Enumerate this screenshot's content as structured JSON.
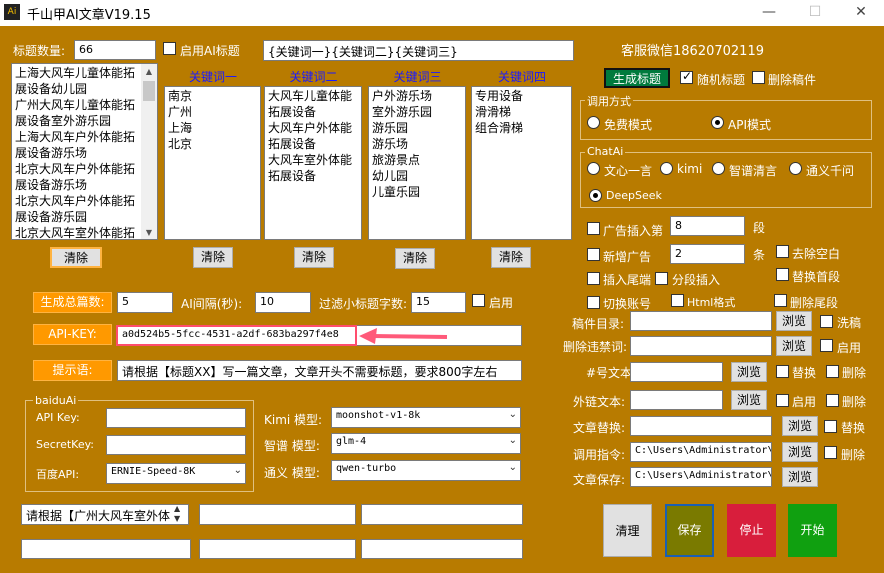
{
  "window": {
    "title": "千山甲AI文章V19.15",
    "icon": "Ai"
  },
  "labels": {
    "title_count": "标题数量:",
    "enable_ai_title": "启用AI标题",
    "wechat": "客服微信18620702119",
    "gen_count": "生成总篇数:",
    "ai_interval": "AI间隔(秒):",
    "filter_subtitle": "过滤小标题字数:",
    "enable": "启用",
    "api_key": "API-KEY:",
    "prompt": "提示语:",
    "random_title": "随机标题",
    "delete_drafts": "删除稿件",
    "call_mode": "调用方式",
    "free_mode": "免费模式",
    "api_mode": "API模式",
    "chatai": "ChatAi",
    "wenxin": "文心一言",
    "kimi": "kimi",
    "zhipu": "智谱清言",
    "tongyi": "通义千问",
    "deepseek": "DeepSeek",
    "ad_insert": "广告插入第",
    "ad_unit": "段",
    "new_ad": "新增广告",
    "new_ad_unit": "条",
    "remove_blank": "去除空白",
    "insert_tail": "插入尾端",
    "para_insert": "分段插入",
    "replace_first": "替换首段",
    "switch_account": "切换账号",
    "html_format": "Html格式",
    "delete_tail": "删除尾段",
    "draft_dir": "稿件目录:",
    "banned_words": "删除违禁词:",
    "hash_text": "#号文本:",
    "link_text": "外链文本:",
    "article_replace": "文章替换:",
    "call_cmd": "调用指令:",
    "article_save": "文章保存:",
    "wash": "洗稿",
    "replace": "替换",
    "delete": "删除",
    "baiduai": "baiduAi",
    "baidu_api_key": "API Key:",
    "baidu_secret": "SecretKey:",
    "baidu_api": "百度API:",
    "kimi_model": "Kimi 模型:",
    "zhipu_model": "智谱 模型:",
    "tongyi_model": "通义 模型:"
  },
  "buttons": {
    "generate_title": "生成标题",
    "clear": "清除",
    "browse": "浏览",
    "clean": "清理",
    "save": "保存",
    "stop": "停止",
    "start": "开始"
  },
  "inputs": {
    "title_count": "66",
    "keyword_template": "{关键词一}{关键词二}{关键词三}",
    "gen_count": "5",
    "ai_interval": "10",
    "filter_subtitle": "15",
    "api_key": "a0d524b5-5fcc-4531-a2df-683ba297f4e8",
    "prompt": "请根据【标题XX】写一篇文章，文章开头不需要标题，要求800字左右",
    "ad_insert_para": "8",
    "new_ad_count": "2",
    "call_cmd": "C:\\Users\\Administrator\\",
    "article_save": "C:\\Users\\Administrator\\",
    "baidu_api": "ERNIE-Speed-8K",
    "kimi_model": "moonshot-v1-8k",
    "zhipu_model": "glm-4",
    "tongyi_model": "qwen-turbo",
    "bottom_prompt": "请根据【广州大风车室外体"
  },
  "columns": [
    {
      "header": "",
      "items": [
        "上海大风车儿童体能拓展设备幼儿园",
        "广州大风车儿童体能拓展设备室外游乐园",
        "上海大风车户外体能拓展设备游乐场",
        "北京大风车户外体能拓展设备游乐场",
        "北京大风车户外体能拓展设备游乐园",
        "北京大风车室外体能拓"
      ]
    },
    {
      "header": "关键词一",
      "items": [
        "南京",
        "广州",
        "上海",
        "北京"
      ]
    },
    {
      "header": "关键词二",
      "items": [
        "大风车儿童体能拓展设备",
        "大风车户外体能拓展设备",
        "大风车室外体能拓展设备"
      ]
    },
    {
      "header": "关键词三",
      "items": [
        "户外游乐场",
        "室外游乐园",
        "游乐园",
        "游乐场",
        "旅游景点",
        "幼儿园",
        "儿童乐园"
      ]
    },
    {
      "header": "关键词四",
      "items": [
        "专用设备",
        "滑滑梯",
        "组合滑梯"
      ]
    }
  ],
  "options": {
    "enable_ai_title": false,
    "random_title": true,
    "delete_drafts": false,
    "call_mode": "API模式",
    "chatai": "DeepSeek"
  },
  "colors": {
    "background": "#b87b00",
    "orange_label": "#ff9900",
    "keyword_header": "#1a1aff",
    "generate_title_bg": "#007a3d",
    "save_bg": "#7a7a00",
    "stop_bg": "#d81e3c",
    "start_bg": "#10a010",
    "highlight_border": "#ff4d6d"
  }
}
